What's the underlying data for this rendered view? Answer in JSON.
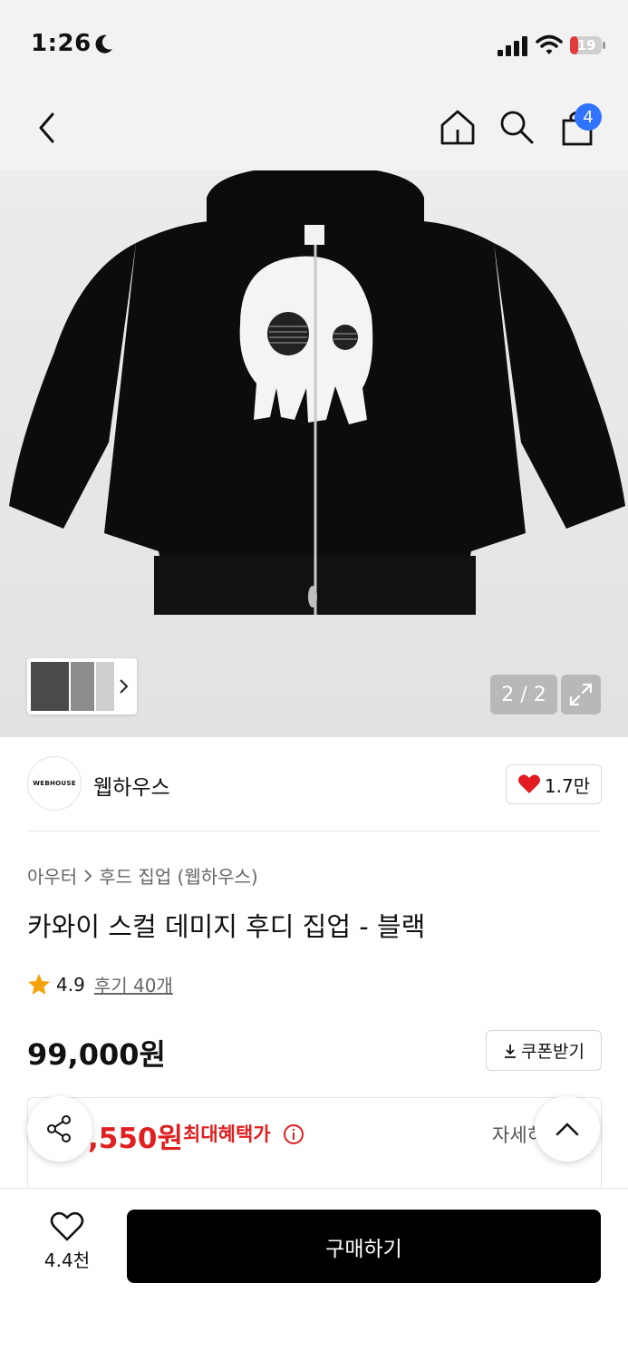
{
  "status_bar": {
    "time": "1:26",
    "battery": "19"
  },
  "header": {
    "cart_count": "4"
  },
  "gallery": {
    "counter": "2 / 2"
  },
  "brand": {
    "logo_text": "WEBHOUSE",
    "name": "웹하우스",
    "likes": "1.7만"
  },
  "breadcrumb": {
    "category": "아우터",
    "subcategory": "후드 집업 (웹하우스)"
  },
  "product": {
    "title": "카와이 스컬 데미지 후디 집업 - 블랙",
    "rating": "4.9",
    "reviews": "후기 40개",
    "price": "99,000원",
    "coupon_label": "쿠폰받기"
  },
  "benefit": {
    "price": ",550원",
    "label": "최대혜택가",
    "detail": "자세히"
  },
  "bottom_bar": {
    "wish_count": "4.4천",
    "buy_label": "구매하기"
  },
  "colors": {
    "accent_red": "#e02020",
    "badge_blue": "#2f73ff"
  }
}
